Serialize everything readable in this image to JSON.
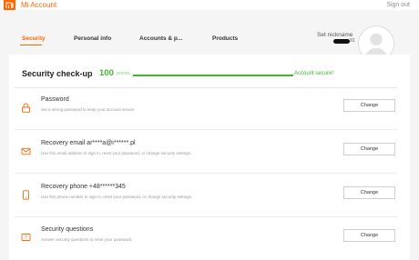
{
  "app": {
    "title": "Mi Account",
    "signout": "Sign out"
  },
  "tabs": [
    {
      "label": "Security"
    },
    {
      "label": "Personal info"
    },
    {
      "label": "Accounts & p..."
    },
    {
      "label": "Products"
    }
  ],
  "profile": {
    "nickname": "Set nickname",
    "uid_tail": "91"
  },
  "security": {
    "title": "Security check-up",
    "points": "100",
    "points_label": "points",
    "progress": 1.0,
    "status": "Account secure!",
    "colors": {
      "accent": "#ff6700",
      "good": "#3db72b"
    }
  },
  "items": [
    {
      "icon": "lock-icon",
      "title": "Password",
      "desc": "Set a strong password to keep your account secure",
      "button": "Change"
    },
    {
      "icon": "mail-icon",
      "title": "Recovery email ar****a@i******.pl",
      "desc": "Use this email address to sign in, reset your password, or change security settings.",
      "button": "Change"
    },
    {
      "icon": "phone-icon",
      "title": "Recovery phone +48******345",
      "desc": "Use this phone number to sign in, reset your password, or change security settings.",
      "button": "Change"
    },
    {
      "icon": "question-icon",
      "title": "Security questions",
      "desc": "Answer security questions to reset your password.",
      "button": "Change"
    }
  ]
}
